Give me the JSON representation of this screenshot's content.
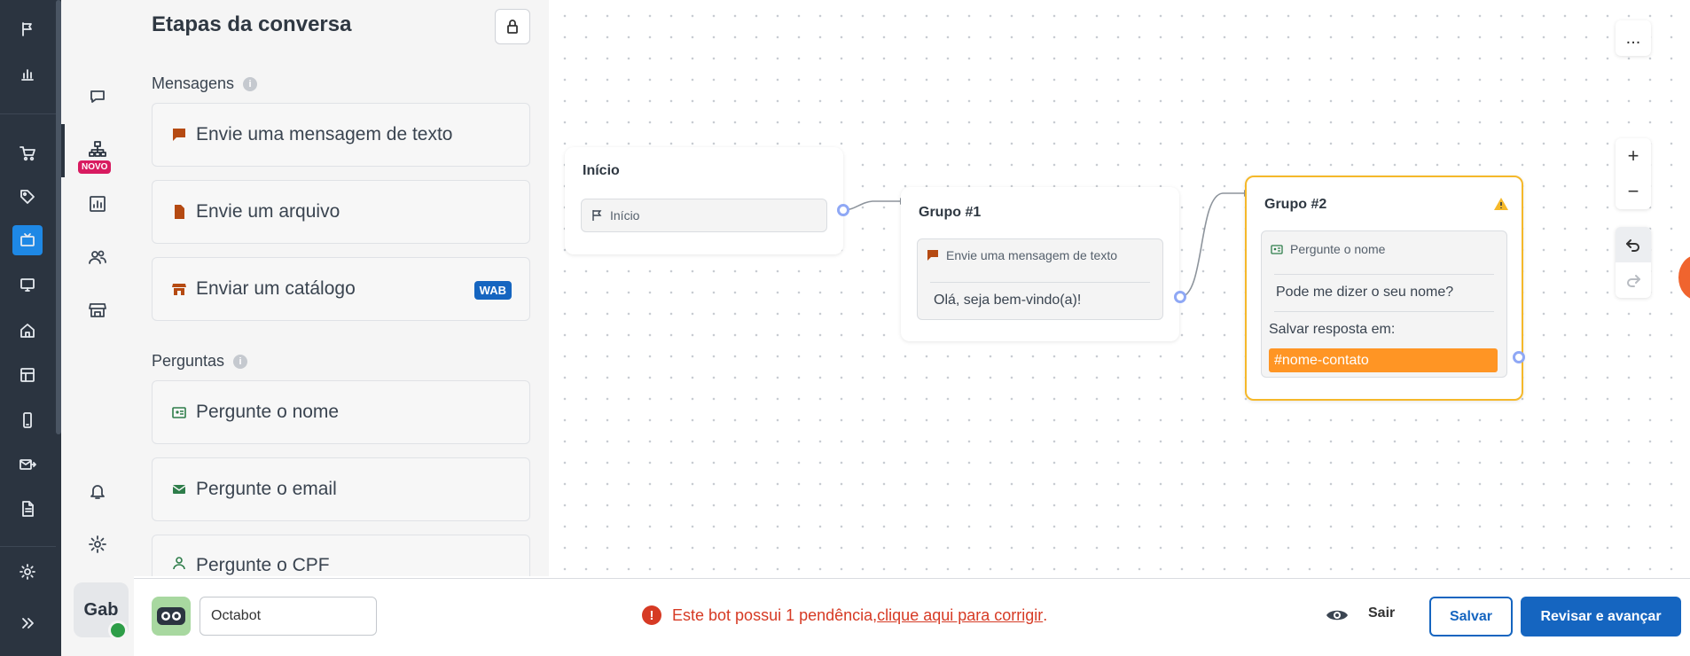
{
  "panel": {
    "title": "Etapas da conversa",
    "sections": {
      "mensagens": "Mensagens",
      "perguntas": "Perguntas"
    },
    "info_glyph": "i",
    "messages": [
      {
        "label": "Envie uma mensagem de texto",
        "icon": "chat-bubble-icon"
      },
      {
        "label": "Envie um arquivo",
        "icon": "file-icon"
      },
      {
        "label": "Enviar um catálogo",
        "icon": "store-icon",
        "badge": "WAB"
      }
    ],
    "questions": [
      {
        "label": "Pergunte o nome",
        "icon": "id-card-icon"
      },
      {
        "label": "Pergunte o email",
        "icon": "mail-icon"
      },
      {
        "label": "Pergunte o CPF",
        "icon": "person-icon"
      }
    ]
  },
  "sidebar": {
    "novo_badge": "NOVO",
    "user_initials": "Gab",
    "active_color": "#1e88e5"
  },
  "canvas": {
    "menu_label": "...",
    "zoom_in": "+",
    "zoom_out": "−",
    "nodes": {
      "inicio": {
        "title": "Início",
        "block_label": "Início"
      },
      "grupo1": {
        "title": "Grupo #1",
        "block_label": "Envie uma mensagem de texto",
        "message": "Olá, seja bem-vindo(a)!"
      },
      "grupo2": {
        "title": "Grupo #2",
        "block_label": "Pergunte o nome",
        "question": "Pode me dizer o seu nome?",
        "save_label": "Salvar resposta em:",
        "variable": "#nome-contato",
        "warning": true
      }
    },
    "colors": {
      "warning_border": "#f5b82a",
      "variable_bg": "#ff9524",
      "handle": "#8fa8f5"
    }
  },
  "bottom": {
    "bot_name": "Octabot",
    "warning_text": "Este bot possui 1 pendência, ",
    "warning_link": "clique aqui para corrigir",
    "warning_end": ".",
    "exit_label": "Sair",
    "save_label": "Salvar",
    "review_label": "Revisar e avançar",
    "primary_color": "#1565c0",
    "error_color": "#d63a24"
  }
}
